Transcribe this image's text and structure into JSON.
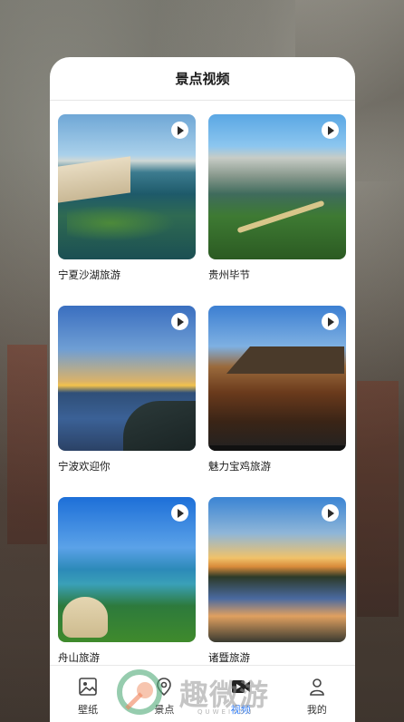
{
  "header": {
    "title": "景点视频"
  },
  "videos": [
    {
      "label": "宁夏沙湖旅游"
    },
    {
      "label": "贵州毕节"
    },
    {
      "label": "宁波欢迎你"
    },
    {
      "label": "魅力宝鸡旅游"
    },
    {
      "label": "舟山旅游"
    },
    {
      "label": "诸暨旅游"
    }
  ],
  "nav": {
    "items": [
      {
        "label": "壁纸",
        "icon": "image-icon",
        "active": false
      },
      {
        "label": "景点",
        "icon": "location-icon",
        "active": false
      },
      {
        "label": "视频",
        "icon": "video-icon",
        "active": true
      },
      {
        "label": "我的",
        "icon": "person-icon",
        "active": false
      }
    ]
  },
  "watermark": {
    "text": "趣微游",
    "sub": "QUWEIYOU"
  },
  "colors": {
    "accent": "#2b7cff"
  }
}
